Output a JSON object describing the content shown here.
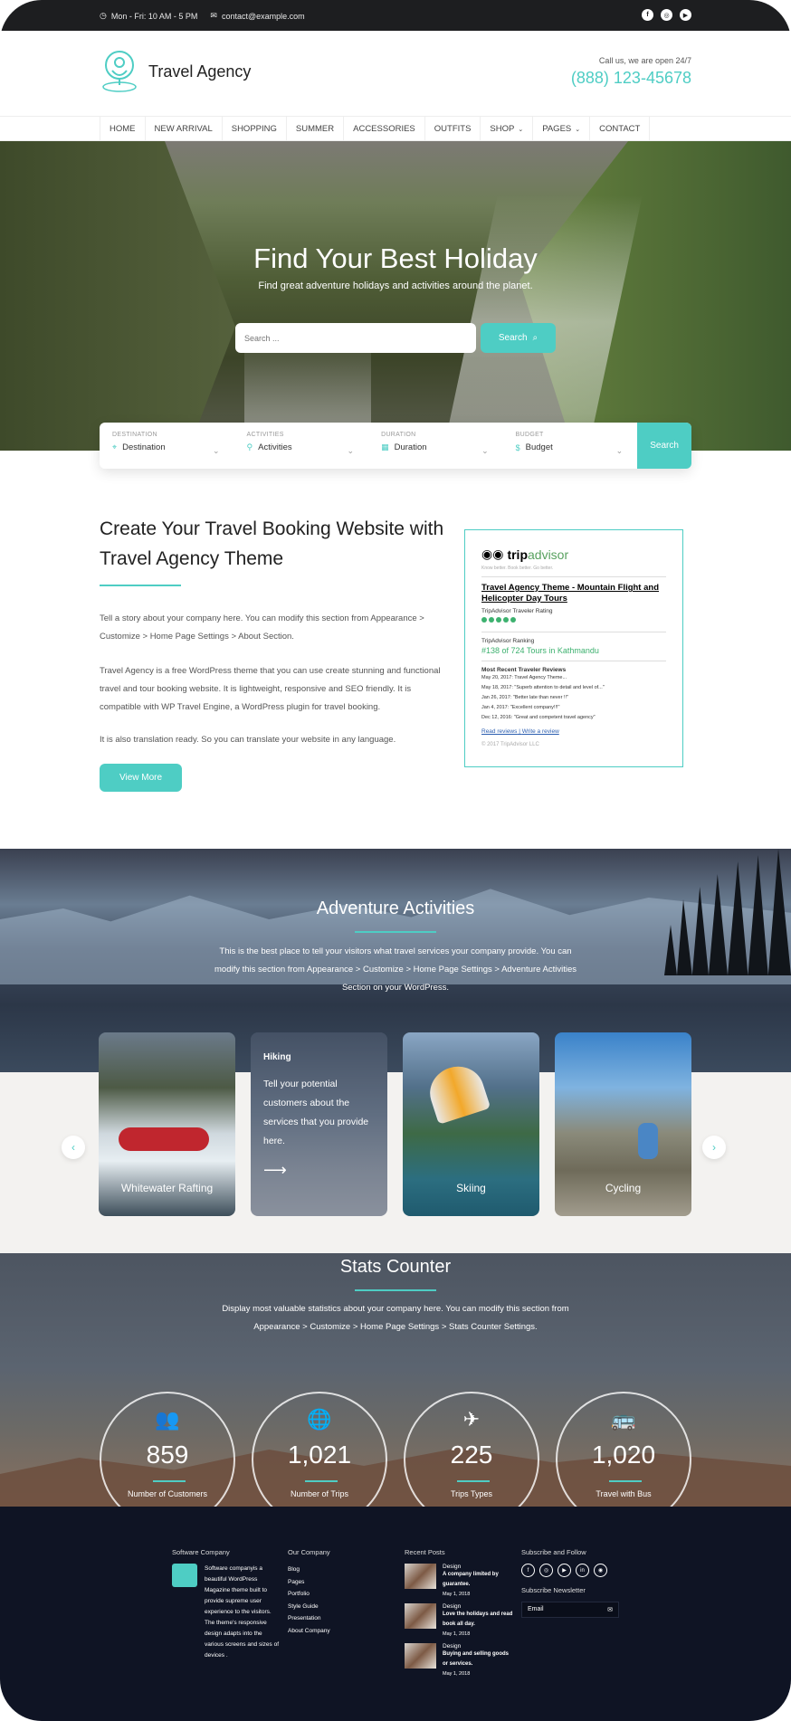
{
  "topbar": {
    "hours": "Mon - Fri: 10 AM - 5 PM",
    "email": "contact@example.com",
    "social": [
      "facebook-icon",
      "instagram-icon",
      "youtube-icon"
    ]
  },
  "header": {
    "site_name": "Travel Agency",
    "call_label": "Call us, we are open 24/7",
    "phone": "(888) 123-45678"
  },
  "nav": {
    "items": [
      {
        "label": "HOME"
      },
      {
        "label": "NEW ARRIVAL"
      },
      {
        "label": "SHOPPING"
      },
      {
        "label": "SUMMER"
      },
      {
        "label": "ACCESSORIES"
      },
      {
        "label": "OUTFITS"
      },
      {
        "label": "SHOP",
        "dropdown": true
      },
      {
        "label": "PAGES",
        "dropdown": true
      },
      {
        "label": "CONTACT"
      }
    ]
  },
  "hero": {
    "title": "Find Your Best Holiday",
    "subtitle": "Find great adventure holidays and activities around the planet.",
    "search_placeholder": "Search ...",
    "search_button": "Search"
  },
  "finder": {
    "fields": [
      {
        "label": "DESTINATION",
        "value": "Destination",
        "icon": "map-pin-icon"
      },
      {
        "label": "ACTIVITIES",
        "value": "Activities",
        "icon": "person-icon"
      },
      {
        "label": "DURATION",
        "value": "Duration",
        "icon": "calendar-icon"
      },
      {
        "label": "BUDGET",
        "value": "Budget",
        "icon": "dollar-icon"
      }
    ],
    "button": "Search"
  },
  "about": {
    "title": "Create Your Travel Booking Website with Travel Agency Theme",
    "p1": "Tell a story about your company here. You can modify this section from Appearance > Customize > Home Page Settings > About Section.",
    "p2": "Travel Agency is a free WordPress theme that you can use create stunning and functional travel and tour booking website. It is lightweight, responsive and SEO friendly. It is compatible with WP Travel Engine, a WordPress plugin for travel booking.",
    "p3": "It is also translation ready. So you can translate your website in any language.",
    "button": "View More"
  },
  "tripadvisor": {
    "brand_a": "trip",
    "brand_b": "advisor",
    "tagline": "Know better. Book better. Go better.",
    "title": "Travel Agency Theme - Mountain Flight and Helicopter Day Tours",
    "rating_label": "TripAdvisor Traveler Rating",
    "ranking_label": "TripAdvisor Ranking",
    "ranking": "#138 of 724 Tours in Kathmandu",
    "reviews_label": "Most Recent Traveler Reviews",
    "reviews": [
      "May 20, 2017: Travel Agency Theme...",
      "May 18, 2017: \"Superb attention to detail and level of...\"",
      "Jan 26, 2017: \"Better late than never !!\"",
      "Jan 4, 2017: \"Excellent company!!!\"",
      "Dec 12, 2016: \"Great and competent travel agency\""
    ],
    "read_reviews": "Read reviews",
    "write_review": "Write a review",
    "copyright": "© 2017 TripAdvisor LLC"
  },
  "adventure": {
    "title": "Adventure Activities",
    "desc": "This is the best place to tell your visitors what travel services your company provide. You can modify this section from Appearance > Customize > Home Page Settings > Adventure Activities Section on your WordPress.",
    "cards": [
      {
        "caption": "Whitewater Rafting"
      },
      {
        "heading": "Hiking",
        "text": "Tell your potential customers about the services that you provide here."
      },
      {
        "caption": "Skiing"
      },
      {
        "caption": "Cycling"
      }
    ]
  },
  "stats": {
    "title": "Stats Counter",
    "desc": "Display most valuable statistics about your company here. You can modify this section from Appearance > Customize > Home Page Settings > Stats Counter Settings.",
    "items": [
      {
        "value": "859",
        "label": "Number of Customers",
        "icon": "users-icon"
      },
      {
        "value": "1,021",
        "label": "Number of Trips",
        "icon": "globe-icon"
      },
      {
        "value": "225",
        "label": "Trips Types",
        "icon": "plane-icon"
      },
      {
        "value": "1,020",
        "label": "Travel with Bus",
        "icon": "bus-icon"
      }
    ]
  },
  "footer": {
    "col1_title": "Software Company",
    "col1_text": "Software companyis a beautiful WordPress Magazine theme built to provide supreme user experience to the visitors. The theme's responsive design adapts into the various screens and sizes of devices .",
    "col2_title": "Our Company",
    "col2_links": [
      "Blog",
      "Pages",
      "Portfolio",
      "Style Guide",
      "Presentation",
      "About Company"
    ],
    "col3_title": "Recent Posts",
    "posts": [
      {
        "category": "Design",
        "title": "A company limited by guarantee.",
        "date": "May 1, 2018"
      },
      {
        "category": "Design",
        "title": "Love the holidays and read book all day.",
        "date": "May 1, 2018"
      },
      {
        "category": "Design",
        "title": "Buying and selling goods or services.",
        "date": "May 1, 2018"
      }
    ],
    "col4_title": "Subscribe and Follow",
    "newsletter_title": "Subscribe Newsletter",
    "email_placeholder": "Email"
  },
  "colors": {
    "accent": "#4ecdc4",
    "dark": "#1d1e20",
    "footer": "#0f1424"
  }
}
